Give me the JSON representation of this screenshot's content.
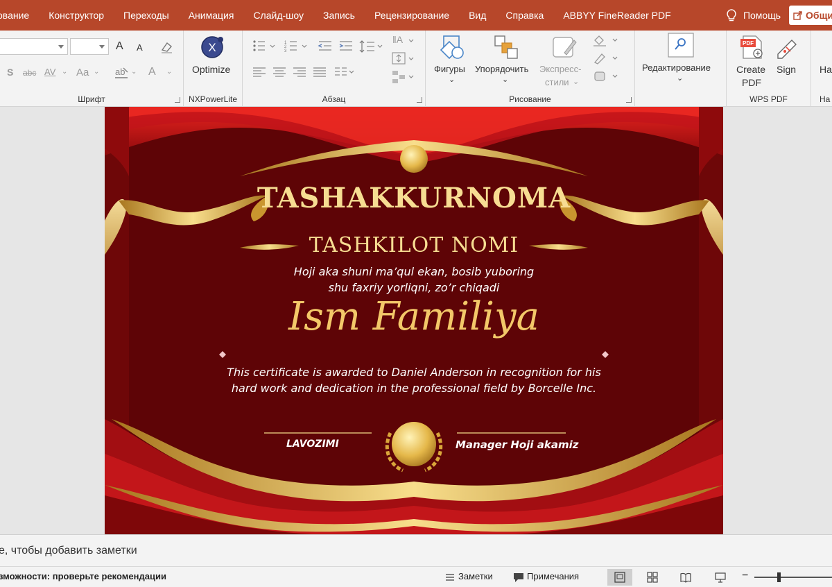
{
  "tabs": [
    "ование",
    "Конструктор",
    "Переходы",
    "Анимация",
    "Слайд-шоу",
    "Запись",
    "Рецензирование",
    "Вид",
    "Справка",
    "ABBYY FineReader PDF"
  ],
  "help_label": "Помощь",
  "share_label": "Общи",
  "ribbon": {
    "font": {
      "label": "Шрифт",
      "font_size_up": "A",
      "font_size_down": "A",
      "shadow": "S",
      "strike": "abc",
      "spacing": "AV",
      "case": "Aa",
      "font_color": "A"
    },
    "nxpower": {
      "label": "NXPowerLite",
      "button": "Optimize",
      "icon_letter": "X"
    },
    "paragraph": {
      "label": "Абзац"
    },
    "drawing": {
      "label": "Рисование",
      "shapes": "Фигуры",
      "arrange": "Упорядочить",
      "quick_styles_1": "Экспресс-",
      "quick_styles_2": "стили"
    },
    "editing": {
      "label": "Редактирование"
    },
    "wps": {
      "label": "WPS PDF",
      "create_1": "Create",
      "create_2": "PDF",
      "sign": "Sign",
      "pdf_badge": "PDF"
    },
    "partial_group": {
      "label": "На",
      "button": "На"
    }
  },
  "certificate": {
    "title": "TASHAKKURNOMA",
    "org": "TASHKILOT NOMI",
    "line1": "Hoji aka shuni ma’qul ekan, bosib yuboring",
    "line2": "shu faxriy yorliqni, zo’r chiqadi",
    "name": "Ism Familiya",
    "body1": "This certificate is awarded to Daniel Anderson in recognition for his",
    "body2": "hard work and dedication in the professional field by Borcelle Inc.",
    "sig_left": "LAVOZIMI",
    "sig_right": "Manager Hoji akamiz"
  },
  "notes_placeholder": "е, чтобы добавить заметки",
  "status": {
    "accessibility": "зможности: проверьте рекомендации",
    "notes_btn": "Заметки",
    "comments_btn": "Примечания"
  }
}
